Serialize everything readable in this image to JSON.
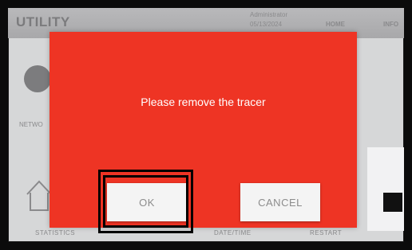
{
  "header": {
    "title": "UTILITY",
    "user": "Administrator",
    "date": "05/13/2024",
    "nav_home": "HOME",
    "nav_info": "INFO"
  },
  "tiles": {
    "network_label": "NETWO",
    "network_icon": "globe-icon",
    "statistics_icon": "home-icon"
  },
  "bottom_labels": [
    "STATISTICS",
    "DATE/TIME",
    "RESTART"
  ],
  "dialog": {
    "message": "Please remove the tracer",
    "ok_label": "OK",
    "cancel_label": "CANCEL",
    "background_color": "#ee3424"
  }
}
